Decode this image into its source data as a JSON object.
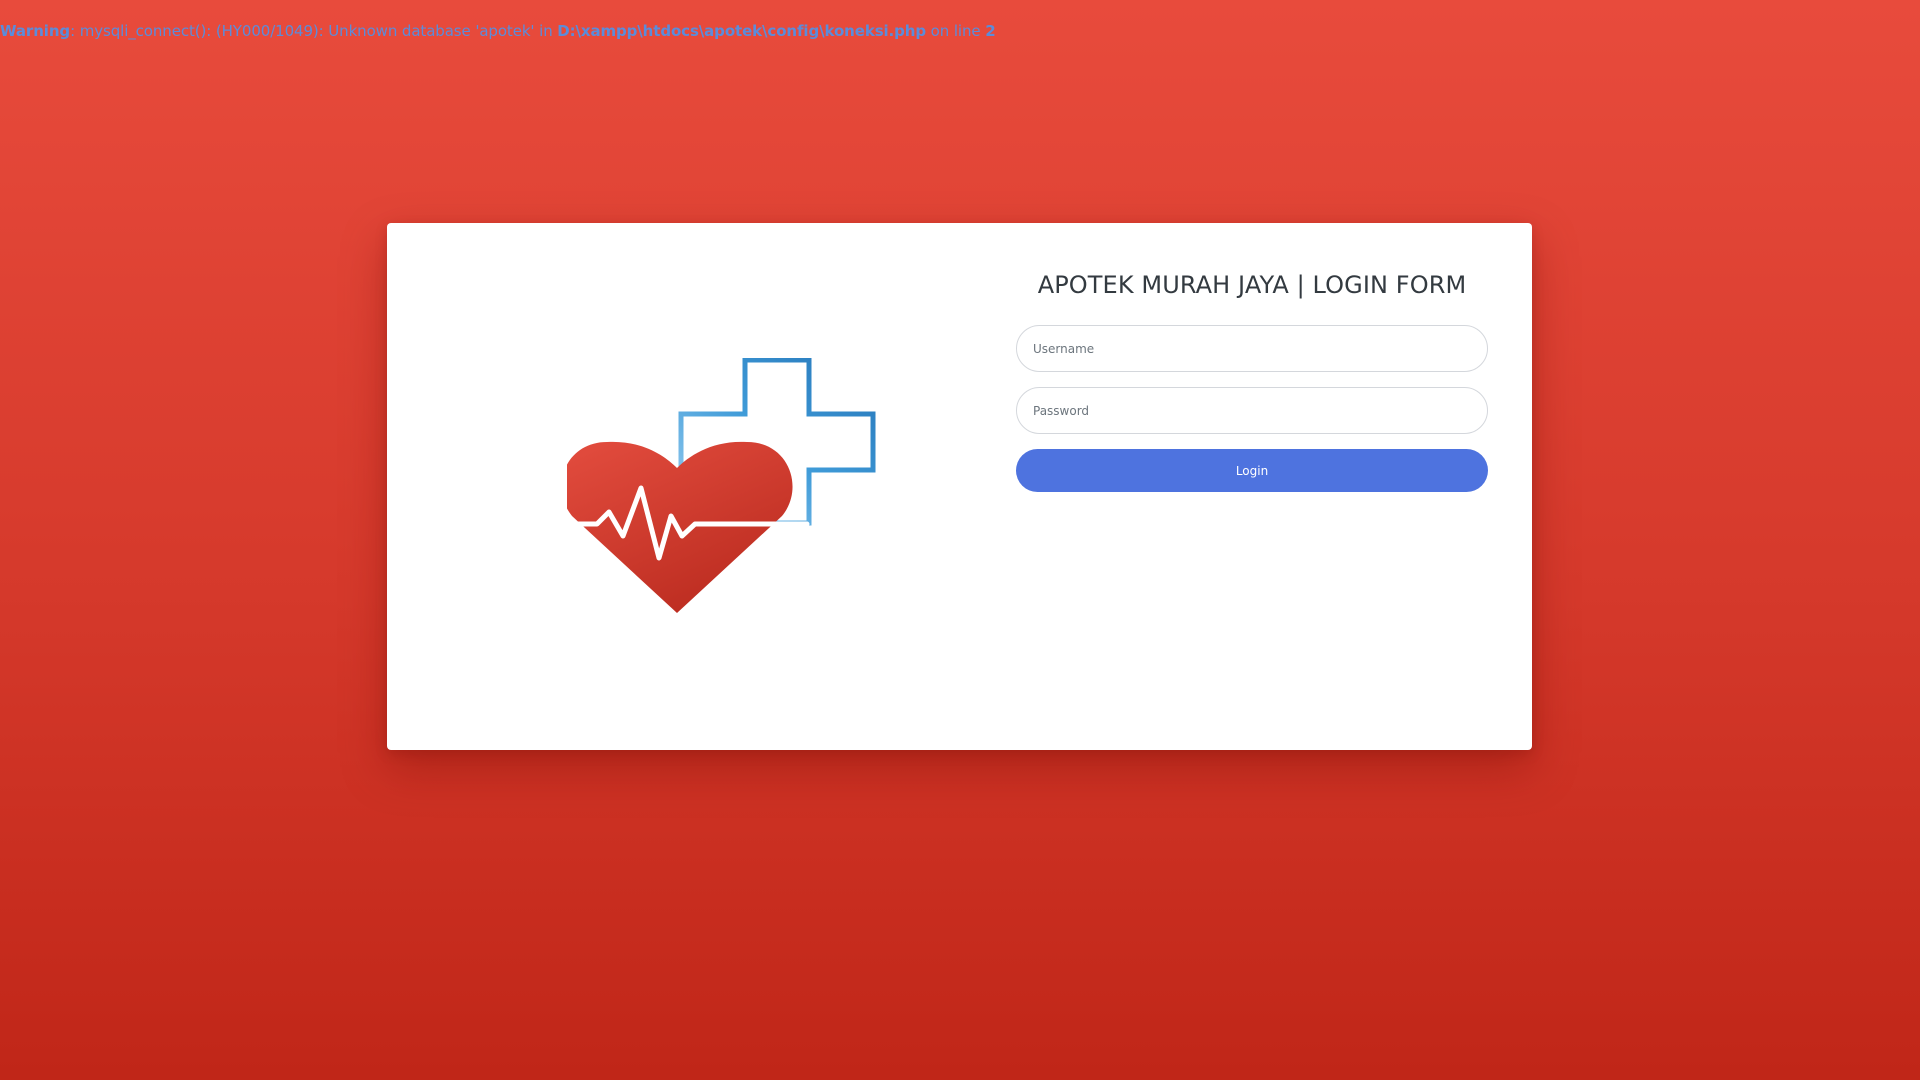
{
  "warning": {
    "label": "Warning",
    "message": ": mysqli_connect(): (HY000/1049): Unknown database 'apotek' in ",
    "path": "D:\\xampp\\htdocs\\apotek\\config\\koneksi.php",
    "line_text": " on line ",
    "line_number": "2"
  },
  "login": {
    "title": "APOTEK MURAH JAYA | LOGIN FORM",
    "username_placeholder": "Username",
    "password_placeholder": "Password",
    "button_label": "Login"
  },
  "colors": {
    "background_top": "#e84b3c",
    "background_bottom": "#c02618",
    "button": "#4e73df",
    "warning_text": "#5b8cdb",
    "heart": "#d5392b",
    "cross": "#2f8ac7"
  },
  "icons": {
    "logo": "heart-cross-heartbeat-icon"
  }
}
